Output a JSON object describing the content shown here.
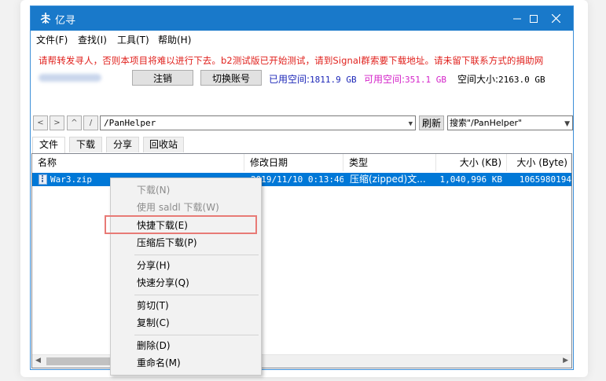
{
  "window": {
    "title": "亿寻"
  },
  "menu": {
    "file": "文件(F)",
    "find": "查找(I)",
    "tools": "工具(T)",
    "help": "帮助(H)"
  },
  "notice": "请帮转发寻人，否则本项目将难以进行下去。b2测试版已开始测试，请到Signal群索要下载地址。请未留下联系方式的捐助网",
  "account": {
    "logout_label": "注销",
    "switch_label": "切换账号",
    "used_label": "已用空间:",
    "used_value": "1811.9 GB",
    "free_label": "可用空间:",
    "free_value": "351.1 GB",
    "total_label": "空间大小:",
    "total_value": "2163.0 GB"
  },
  "nav": {
    "back": "<",
    "forward": ">",
    "up": "^",
    "root": "/"
  },
  "path": {
    "value": "/PanHelper",
    "refresh_label": "刷新",
    "search_value": "搜索\"/PanHelper\""
  },
  "tabs": [
    "文件",
    "下载",
    "分享",
    "回收站"
  ],
  "columns": {
    "name": "名称",
    "modified": "修改日期",
    "type": "类型",
    "size_kb": "大小 (KB)",
    "size_byte": "大小 (Byte)"
  },
  "files": [
    {
      "name": "War3.zip",
      "modified": "2019/11/10 0:13:46",
      "type": "压缩(zipped)文...",
      "size_kb": "1,040,996 KB",
      "size_byte": "1065980194"
    }
  ],
  "context_menu": {
    "download": "下载(N)",
    "saldl_download": "使用 saldl 下载(W)",
    "quick_download": "快捷下载(E)",
    "compress_download": "压缩后下载(P)",
    "share": "分享(H)",
    "quick_share": "快速分享(Q)",
    "cut": "剪切(T)",
    "copy": "复制(C)",
    "delete": "删除(D)",
    "rename": "重命名(M)"
  },
  "colors": {
    "titlebar": "#1979ca",
    "notice": "#e0201c",
    "used_space": "#1d27b8",
    "free_space": "#d424c9",
    "selection": "#0078d7",
    "highlight": "#e87a76"
  },
  "icons": [
    "app-icon",
    "minimize-icon",
    "maximize-icon",
    "close-icon",
    "zip-file-icon",
    "dropdown-arrow-icon"
  ]
}
